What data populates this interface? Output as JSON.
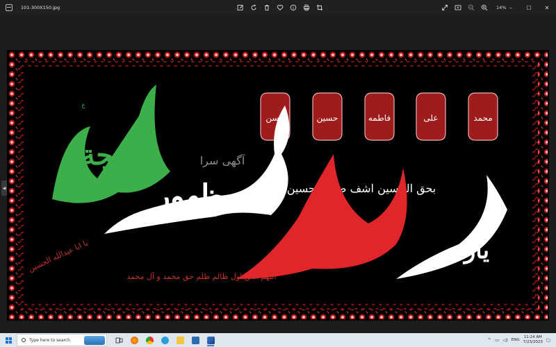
{
  "window": {
    "file_name": "101-300X150.jpg",
    "zoom": "14%"
  },
  "toolbar": {
    "icons": [
      "edit-icon",
      "rotate-icon",
      "delete-icon",
      "favorite-icon",
      "info-icon",
      "print-icon",
      "crop-icon"
    ]
  },
  "toolbar_right": {
    "icons": [
      "expand-icon",
      "slideshow-icon",
      "zoom-out-icon",
      "zoom-in-icon"
    ]
  },
  "controls": {
    "minimize": "–",
    "maximize": "☐",
    "close": "✕"
  },
  "artwork": {
    "watermark": "آگهی سرا",
    "background": "#000000",
    "colors": {
      "green": "#3cae4a",
      "white": "#ffffff",
      "red": "#e0262b",
      "border_red": "#b31a1a",
      "badge": "#a01c1c"
    },
    "badges": [
      "محمد",
      "علی",
      "فاطمه",
      "حسن",
      "حسین"
    ],
    "green_phrase": "الحجة",
    "white_phrase": "بظهور",
    "red_phrase": "الحسین",
    "white_left_phrase": "یارب",
    "small_phrase": "بحق الحسین اشف صدر الحسین",
    "red_bottom_line": "اللهم العن اول ظالم ظلم حق محمد و آل محمد",
    "side_script": "یا ابا عبدالله الحسین"
  },
  "taskbar": {
    "search_placeholder": "Type here to search",
    "lang": "ENG",
    "time": "11:24 AM",
    "date": "7/23/2023"
  }
}
